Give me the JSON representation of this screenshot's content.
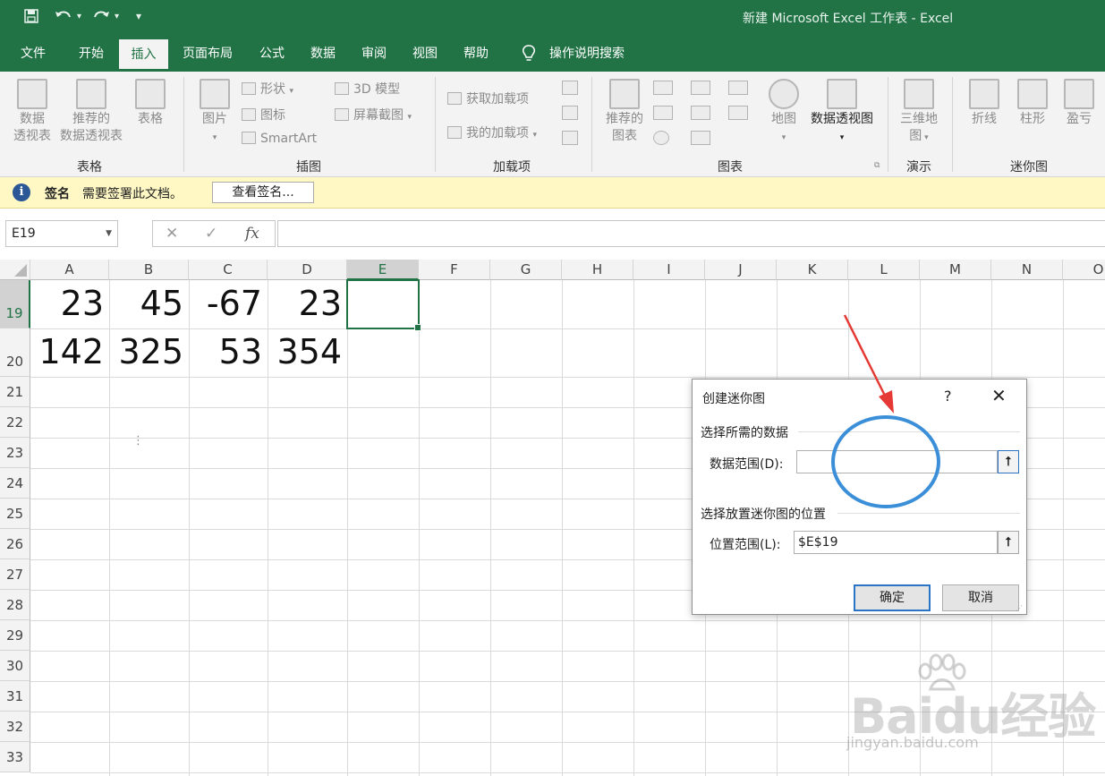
{
  "window": {
    "title": "新建 Microsoft Excel 工作表  -  Excel"
  },
  "quick_access": {
    "save": "save-icon",
    "undo": "undo-icon",
    "redo": "redo-icon",
    "customize": "▾"
  },
  "menu": {
    "tabs": [
      "文件",
      "开始",
      "插入",
      "页面布局",
      "公式",
      "数据",
      "审阅",
      "视图",
      "帮助"
    ],
    "active": "插入",
    "search": "操作说明搜索"
  },
  "ribbon": {
    "tables": {
      "pivot": [
        "数据",
        "透视表"
      ],
      "recommended": [
        "推荐的",
        "数据透视表"
      ],
      "table": "表格",
      "group": "表格"
    },
    "illustrations": {
      "pictures": "图片",
      "shapes": "形状",
      "icons": "图标",
      "smartart": "SmartArt",
      "model3d": "3D 模型",
      "screenshot": "屏幕截图",
      "group": "插图"
    },
    "addins": {
      "get": "获取加载项",
      "mine": "我的加载项",
      "group": "加载项"
    },
    "charts": {
      "recommended": [
        "推荐的",
        "图表"
      ],
      "map": "地图",
      "pivotchart": "数据透视图",
      "group": "图表"
    },
    "tours": {
      "map3d": [
        "三维地",
        "图"
      ],
      "group": "演示"
    },
    "sparklines": {
      "line": "折线",
      "column": "柱形",
      "winloss": "盈亏",
      "group": "迷你图"
    }
  },
  "infobar": {
    "title": "签名",
    "message": "需要签署此文档。",
    "button": "查看签名..."
  },
  "formula_bar": {
    "name_box": "E19",
    "cancel": "✕",
    "enter": "✓",
    "fx": "fx",
    "value": ""
  },
  "sheet": {
    "columns": [
      "A",
      "B",
      "C",
      "D",
      "E",
      "F",
      "G",
      "H",
      "I",
      "J",
      "K",
      "L",
      "M",
      "N",
      "O"
    ],
    "selected_column": "E",
    "rows": [
      "19",
      "20",
      "21",
      "22",
      "23",
      "24",
      "25",
      "26",
      "27",
      "28",
      "29",
      "30",
      "31",
      "32",
      "33"
    ],
    "selected_row": "19",
    "data": {
      "row19": [
        "23",
        "45",
        "-67",
        "23"
      ],
      "row20": [
        "142",
        "325",
        "53",
        "354"
      ]
    }
  },
  "dialog": {
    "title": "创建迷你图",
    "help": "?",
    "close": "✕",
    "section_data": "选择所需的数据",
    "data_range_label": "数据范围(D):",
    "data_range_value": "",
    "section_location": "选择放置迷你图的位置",
    "location_label": "位置范围(L):",
    "location_value": "$E$19",
    "ok": "确定",
    "cancel": "取消"
  },
  "watermark": {
    "brand": "Baidu经验",
    "url": "jingyan.baidu.com"
  },
  "colors": {
    "excel_green": "#217346",
    "annotation_red": "#e53935",
    "annotation_blue": "#3b8fd9"
  }
}
